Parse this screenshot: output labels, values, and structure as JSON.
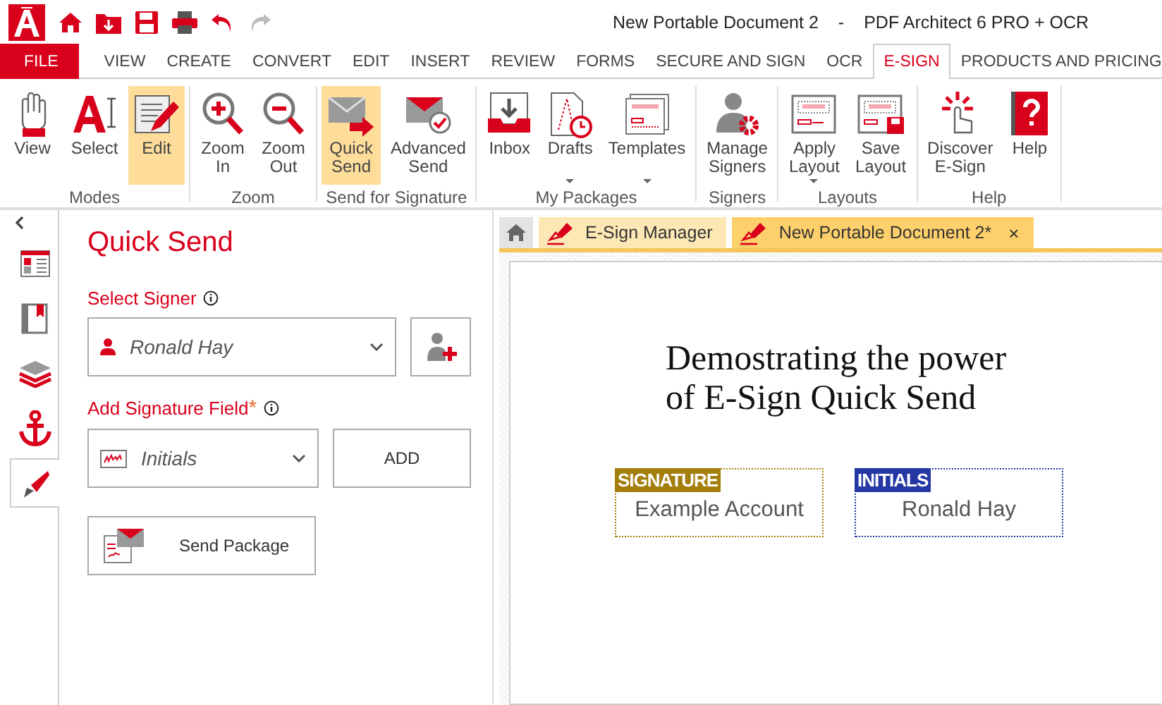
{
  "window": {
    "title": "New Portable Document 2",
    "separator": "-",
    "app_name": "PDF Architect 6 PRO + OCR"
  },
  "quick_access": [
    {
      "kind": "home",
      "disabled": false
    },
    {
      "kind": "open",
      "disabled": false
    },
    {
      "kind": "save",
      "disabled": false
    },
    {
      "kind": "print",
      "disabled": false
    },
    {
      "kind": "undo",
      "disabled": false
    },
    {
      "kind": "redo",
      "disabled": true
    }
  ],
  "menu_tabs": [
    {
      "label": "FILE",
      "kind": "file",
      "selected": false
    },
    {
      "label": "VIEW",
      "kind": "tab",
      "selected": false
    },
    {
      "label": "CREATE",
      "kind": "tab",
      "selected": false
    },
    {
      "label": "CONVERT",
      "kind": "tab",
      "selected": false
    },
    {
      "label": "EDIT",
      "kind": "tab",
      "selected": false
    },
    {
      "label": "INSERT",
      "kind": "tab",
      "selected": false
    },
    {
      "label": "REVIEW",
      "kind": "tab",
      "selected": false
    },
    {
      "label": "FORMS",
      "kind": "tab",
      "selected": false
    },
    {
      "label": "SECURE AND SIGN",
      "kind": "tab",
      "selected": false
    },
    {
      "label": "OCR",
      "kind": "tab",
      "selected": false
    },
    {
      "label": "E-SIGN",
      "kind": "tab",
      "selected": true
    },
    {
      "label": "PRODUCTS AND PRICING",
      "kind": "tab",
      "selected": false
    }
  ],
  "ribbon_groups": [
    {
      "label": "Modes",
      "buttons": [
        {
          "label": "View",
          "kind": "hand",
          "selected": false,
          "dropdown": false
        },
        {
          "label": "Select",
          "kind": "select",
          "selected": false,
          "dropdown": false
        },
        {
          "label": "Edit",
          "kind": "edit",
          "selected": true,
          "dropdown": false
        }
      ]
    },
    {
      "label": "Zoom",
      "buttons": [
        {
          "label": "Zoom In",
          "kind": "zoom-in",
          "selected": false,
          "dropdown": false
        },
        {
          "label": "Zoom Out",
          "kind": "zoom-out",
          "selected": false,
          "dropdown": false
        }
      ]
    },
    {
      "label": "Send for Signature",
      "buttons": [
        {
          "label": "Quick Send",
          "kind": "quick-send",
          "selected": true,
          "dropdown": false
        },
        {
          "label": "Advanced Send",
          "kind": "advanced-send",
          "selected": false,
          "dropdown": false
        }
      ]
    },
    {
      "label": "My Packages",
      "buttons": [
        {
          "label": "Inbox",
          "kind": "inbox",
          "selected": false,
          "dropdown": false
        },
        {
          "label": "Drafts",
          "kind": "drafts",
          "selected": false,
          "dropdown": true
        },
        {
          "label": "Templates",
          "kind": "templates",
          "selected": false,
          "dropdown": true
        }
      ]
    },
    {
      "label": "Signers",
      "buttons": [
        {
          "label": "Manage Signers",
          "kind": "signers",
          "selected": false,
          "dropdown": false
        }
      ]
    },
    {
      "label": "Layouts",
      "buttons": [
        {
          "label": "Apply Layout",
          "kind": "apply-layout",
          "selected": false,
          "dropdown": true
        },
        {
          "label": "Save Layout",
          "kind": "save-layout",
          "selected": false,
          "dropdown": false
        }
      ]
    },
    {
      "label": "Help",
      "buttons": [
        {
          "label": "Discover E-Sign",
          "kind": "discover",
          "selected": false,
          "dropdown": false
        },
        {
          "label": "Help",
          "kind": "help",
          "selected": false,
          "dropdown": false
        }
      ]
    }
  ],
  "side_rail": [
    {
      "kind": "pages",
      "selected": false
    },
    {
      "kind": "bookmarks",
      "selected": false
    },
    {
      "kind": "layers",
      "selected": false
    },
    {
      "kind": "anchor",
      "selected": false
    },
    {
      "kind": "esign",
      "selected": true
    }
  ],
  "quick_send": {
    "title": "Quick Send",
    "signer_label": "Select Signer",
    "signer": "Ronald Hay",
    "field_label": "Add Signature Field",
    "required_mark": "*",
    "field_type": "Initials",
    "add_button": "ADD",
    "send_button": "Send Package"
  },
  "doc_tabs": [
    {
      "kind": "home",
      "selected": false
    },
    {
      "kind": "doc",
      "label": "E-Sign Manager",
      "selected": false
    },
    {
      "kind": "doc",
      "label": "New Portable Document 2*",
      "selected": true,
      "close": "×"
    }
  ],
  "document": {
    "heading": "Demostrating the power of E-Sign Quick Send",
    "fields": [
      {
        "tag": "SIGNATURE",
        "name": "Example Account",
        "color": "#a47e0a"
      },
      {
        "tag": "INITIALS",
        "name": "Ronald Hay",
        "color": "#2437a3"
      }
    ]
  }
}
